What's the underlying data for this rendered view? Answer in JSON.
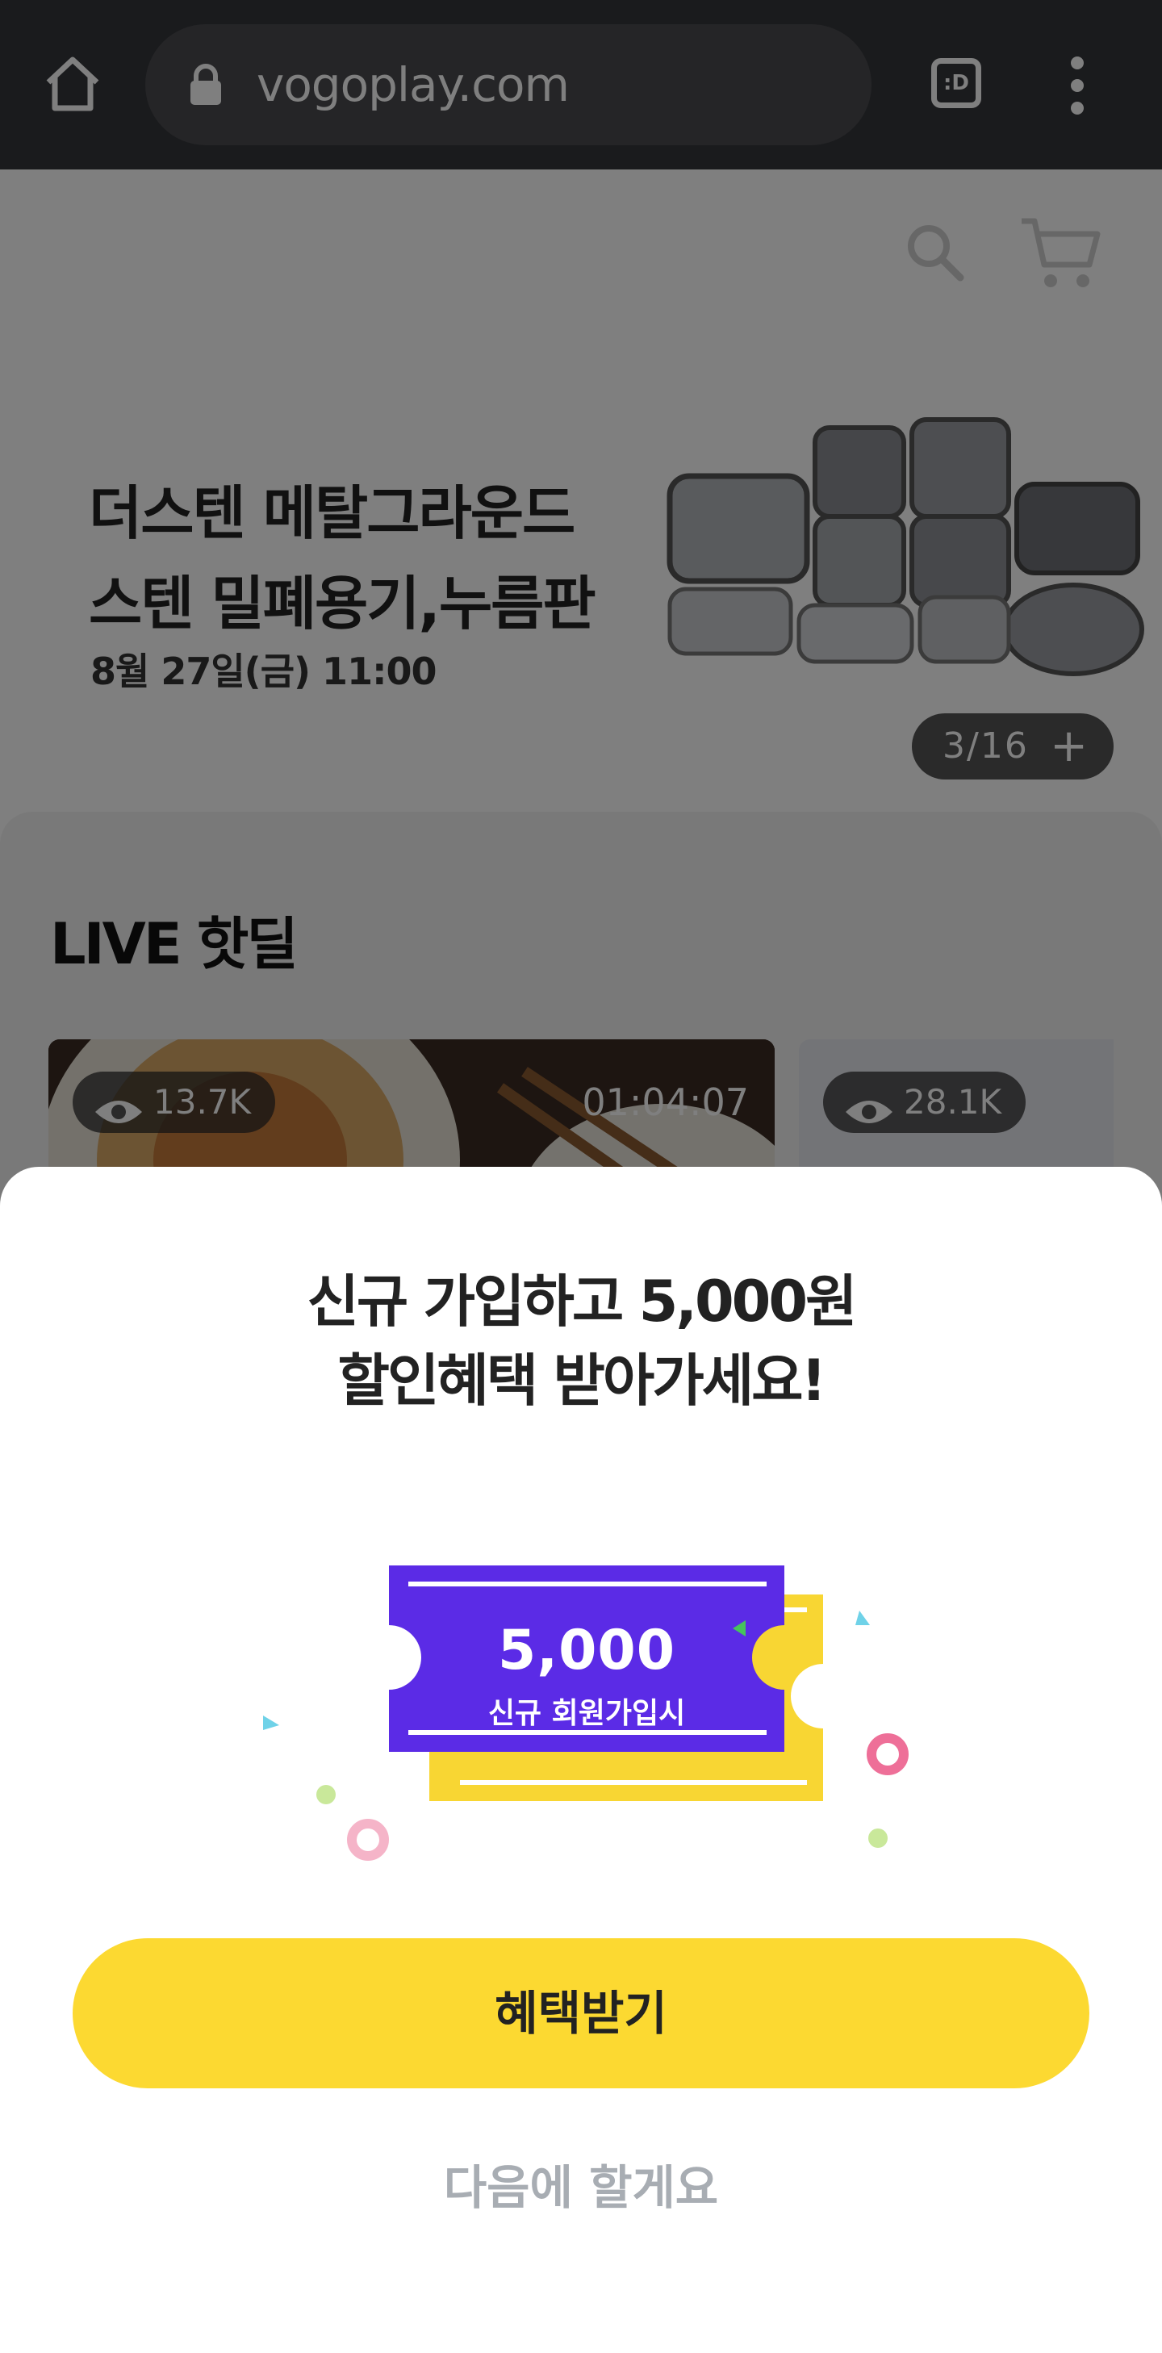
{
  "browser": {
    "url": "vogoplay.com",
    "tab_icon_label": ":D"
  },
  "hero": {
    "title_line1": "더스텐 메탈그라운드",
    "title_line2": "스텐 밀폐용기,누름판",
    "date": "8월 27일(금) 11:00",
    "pager": "3/16",
    "pager_plus": "+"
  },
  "live": {
    "section_title": "LIVE 핫딜",
    "cards": [
      {
        "views": "13.7K",
        "duration": "01:04:07"
      },
      {
        "views": "28.1K"
      }
    ]
  },
  "sheet": {
    "title_line1": "신규 가입하고 5,000원",
    "title_line2": "할인혜택 받아가세요!",
    "coupon_amount": "5,000",
    "coupon_caption": "신규 회원가입시",
    "primary_button": "혜택받기",
    "secondary_link": "다음에 할게요"
  },
  "colors": {
    "browser_bar": "#35363a",
    "primary_yellow": "#fcd931",
    "coupon_purple": "#5b2be6",
    "coupon_yellow": "#f8d633",
    "secondary_text": "#a8adb3"
  },
  "icons": [
    "home-icon",
    "lock-icon",
    "tab-switcher-icon",
    "more-vert-icon",
    "search-icon",
    "cart-icon",
    "eye-icon"
  ]
}
